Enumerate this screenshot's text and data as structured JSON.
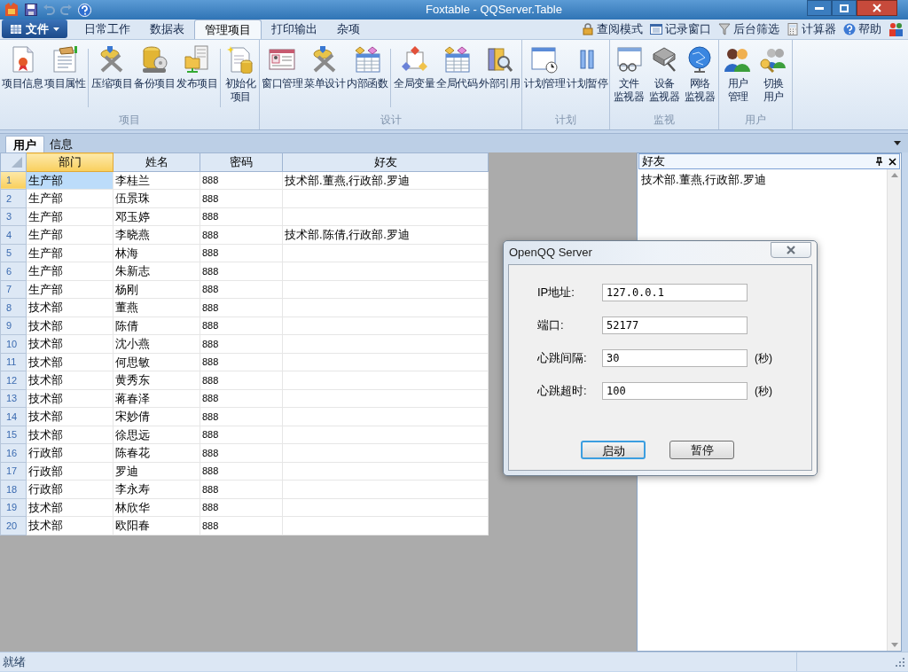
{
  "window": {
    "title": "Foxtable - QQServer.Table"
  },
  "ribbon_tabs": [
    {
      "label": "文件",
      "kind": "menu",
      "selected": false
    },
    {
      "label": "日常工作",
      "kind": "tab",
      "selected": false
    },
    {
      "label": "数据表",
      "kind": "tab",
      "selected": false
    },
    {
      "label": "管理项目",
      "kind": "tab",
      "selected": true
    },
    {
      "label": "打印输出",
      "kind": "tab",
      "selected": false
    },
    {
      "label": "杂项",
      "kind": "tab",
      "selected": false
    }
  ],
  "quick_links": [
    {
      "label": "查阅模式"
    },
    {
      "label": "记录窗口"
    },
    {
      "label": "后台筛选"
    },
    {
      "label": "计算器"
    },
    {
      "label": "帮助"
    }
  ],
  "ribbon_groups": [
    {
      "label": "项目",
      "sections": [
        [
          {
            "lines": [
              "项目信息"
            ]
          },
          {
            "lines": [
              "项目属性"
            ]
          }
        ],
        [
          {
            "lines": [
              "压缩项目"
            ]
          },
          {
            "lines": [
              "备份项目"
            ]
          },
          {
            "lines": [
              "发布项目"
            ]
          }
        ],
        [
          {
            "lines": [
              "初始化",
              "项目"
            ]
          }
        ]
      ]
    },
    {
      "label": "设计",
      "sections": [
        [
          {
            "lines": [
              "窗口管理"
            ]
          },
          {
            "lines": [
              "菜单设计"
            ]
          },
          {
            "lines": [
              "内部函数"
            ]
          }
        ],
        [
          {
            "lines": [
              "全局变量"
            ]
          },
          {
            "lines": [
              "全局代码"
            ]
          },
          {
            "lines": [
              "外部引用"
            ]
          }
        ]
      ]
    },
    {
      "label": "计划",
      "sections": [
        [
          {
            "lines": [
              "计划管理"
            ]
          },
          {
            "lines": [
              "计划暂停"
            ]
          }
        ]
      ]
    },
    {
      "label": "监视",
      "sections": [
        [
          {
            "lines": [
              "文件",
              "监视器"
            ]
          },
          {
            "lines": [
              "设备",
              "监视器"
            ]
          },
          {
            "lines": [
              "网络",
              "监视器"
            ]
          }
        ]
      ]
    },
    {
      "label": "用户",
      "sections": [
        [
          {
            "lines": [
              "用户",
              "管理"
            ]
          },
          {
            "lines": [
              "切换",
              "用户"
            ]
          }
        ]
      ]
    }
  ],
  "doc_tabs": [
    {
      "label": "用户",
      "selected": true
    },
    {
      "label": "信息",
      "selected": false
    }
  ],
  "table": {
    "columns": [
      {
        "label": "部门",
        "selected": true
      },
      {
        "label": "姓名",
        "selected": false
      },
      {
        "label": "密码",
        "selected": false
      },
      {
        "label": "好友",
        "selected": false
      }
    ],
    "rows": [
      {
        "number": "1",
        "selected": true,
        "cells": [
          "生产部",
          "李桂兰",
          "888",
          "技术部.董燕,行政部.罗迪"
        ]
      },
      {
        "number": "2",
        "selected": false,
        "cells": [
          "生产部",
          "伍景珠",
          "888",
          ""
        ]
      },
      {
        "number": "3",
        "selected": false,
        "cells": [
          "生产部",
          "邓玉婷",
          "888",
          ""
        ]
      },
      {
        "number": "4",
        "selected": false,
        "cells": [
          "生产部",
          "李晓燕",
          "888",
          "技术部.陈倩,行政部.罗迪"
        ]
      },
      {
        "number": "5",
        "selected": false,
        "cells": [
          "生产部",
          "林海",
          "888",
          ""
        ]
      },
      {
        "number": "6",
        "selected": false,
        "cells": [
          "生产部",
          "朱新志",
          "888",
          ""
        ]
      },
      {
        "number": "7",
        "selected": false,
        "cells": [
          "生产部",
          "杨刚",
          "888",
          ""
        ]
      },
      {
        "number": "8",
        "selected": false,
        "cells": [
          "技术部",
          "董燕",
          "888",
          ""
        ]
      },
      {
        "number": "9",
        "selected": false,
        "cells": [
          "技术部",
          "陈倩",
          "888",
          ""
        ]
      },
      {
        "number": "10",
        "selected": false,
        "cells": [
          "技术部",
          "沈小燕",
          "888",
          ""
        ]
      },
      {
        "number": "11",
        "selected": false,
        "cells": [
          "技术部",
          "何思敏",
          "888",
          ""
        ]
      },
      {
        "number": "12",
        "selected": false,
        "cells": [
          "技术部",
          "黄秀东",
          "888",
          ""
        ]
      },
      {
        "number": "13",
        "selected": false,
        "cells": [
          "技术部",
          "蒋春泽",
          "888",
          ""
        ]
      },
      {
        "number": "14",
        "selected": false,
        "cells": [
          "技术部",
          "宋妙倩",
          "888",
          ""
        ]
      },
      {
        "number": "15",
        "selected": false,
        "cells": [
          "技术部",
          "徐思远",
          "888",
          ""
        ]
      },
      {
        "number": "16",
        "selected": false,
        "cells": [
          "行政部",
          "陈春花",
          "888",
          ""
        ]
      },
      {
        "number": "17",
        "selected": false,
        "cells": [
          "行政部",
          "罗迪",
          "888",
          ""
        ]
      },
      {
        "number": "18",
        "selected": false,
        "cells": [
          "行政部",
          "李永寿",
          "888",
          ""
        ]
      },
      {
        "number": "19",
        "selected": false,
        "cells": [
          "技术部",
          "林欣华",
          "888",
          ""
        ]
      },
      {
        "number": "20",
        "selected": false,
        "cells": [
          "技术部",
          "欧阳春",
          "888",
          ""
        ]
      }
    ]
  },
  "side_panel": {
    "title": "好友",
    "text": "技术部.董燕,行政部.罗迪"
  },
  "dialog": {
    "title": "OpenQQ Server",
    "fields": [
      {
        "label": "IP地址:",
        "value": "127.0.0.1"
      },
      {
        "label": "端口:",
        "value": "52177"
      },
      {
        "label": "心跳间隔:",
        "value": "30",
        "unit": "(秒)"
      },
      {
        "label": "心跳超时:",
        "value": "100",
        "unit": "(秒)"
      }
    ],
    "buttons": [
      {
        "label": "启动",
        "default": true
      },
      {
        "label": "暂停",
        "default": false
      }
    ]
  },
  "status_bar": {
    "text": "就绪"
  }
}
